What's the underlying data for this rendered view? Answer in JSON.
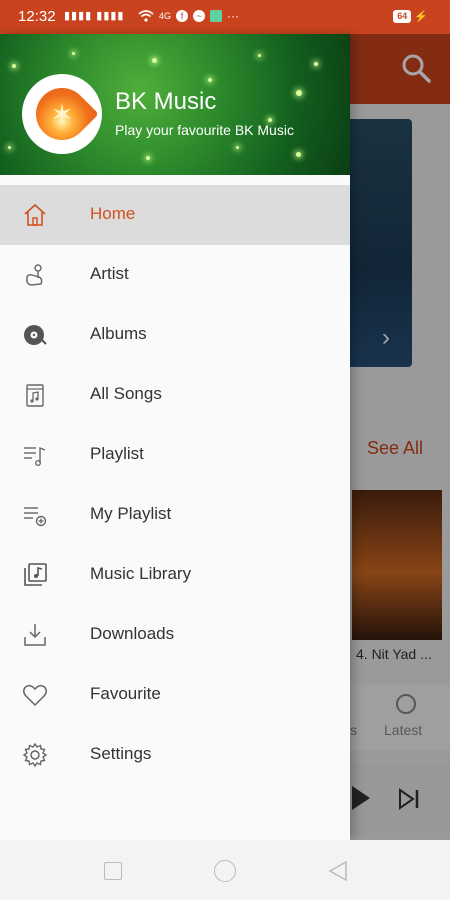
{
  "status_bar": {
    "time": "12:32",
    "signal": "▮▮▮▮ ▮▮▮▮",
    "network": "4G",
    "notification_icons": [
      "wifi-icon",
      "facebook-icon",
      "messenger-icon",
      "app-icon"
    ],
    "more": "···",
    "battery": "64"
  },
  "drawer": {
    "header": {
      "title": "BK Music",
      "subtitle": "Play your favourite BK Music"
    },
    "items": [
      {
        "label": "Home",
        "icon": "home-icon",
        "active": true
      },
      {
        "label": "Artist",
        "icon": "artist-icon",
        "active": false
      },
      {
        "label": "Albums",
        "icon": "album-disc-icon",
        "active": false
      },
      {
        "label": "All Songs",
        "icon": "song-file-icon",
        "active": false
      },
      {
        "label": "Playlist",
        "icon": "playlist-icon",
        "active": false
      },
      {
        "label": "My Playlist",
        "icon": "my-playlist-icon",
        "active": false
      },
      {
        "label": "Music Library",
        "icon": "music-library-icon",
        "active": false
      },
      {
        "label": "Downloads",
        "icon": "download-icon",
        "active": false
      },
      {
        "label": "Favourite",
        "icon": "heart-icon",
        "active": false
      },
      {
        "label": "Settings",
        "icon": "gear-icon",
        "active": false
      }
    ]
  },
  "background": {
    "see_all": "See All",
    "card_title": "4. Nit Yad ...",
    "tab_partial": "s",
    "tab_latest": "Latest"
  },
  "colors": {
    "accent": "#c9441e",
    "active_text": "#d2501f",
    "active_bg": "#dcdcdc"
  }
}
